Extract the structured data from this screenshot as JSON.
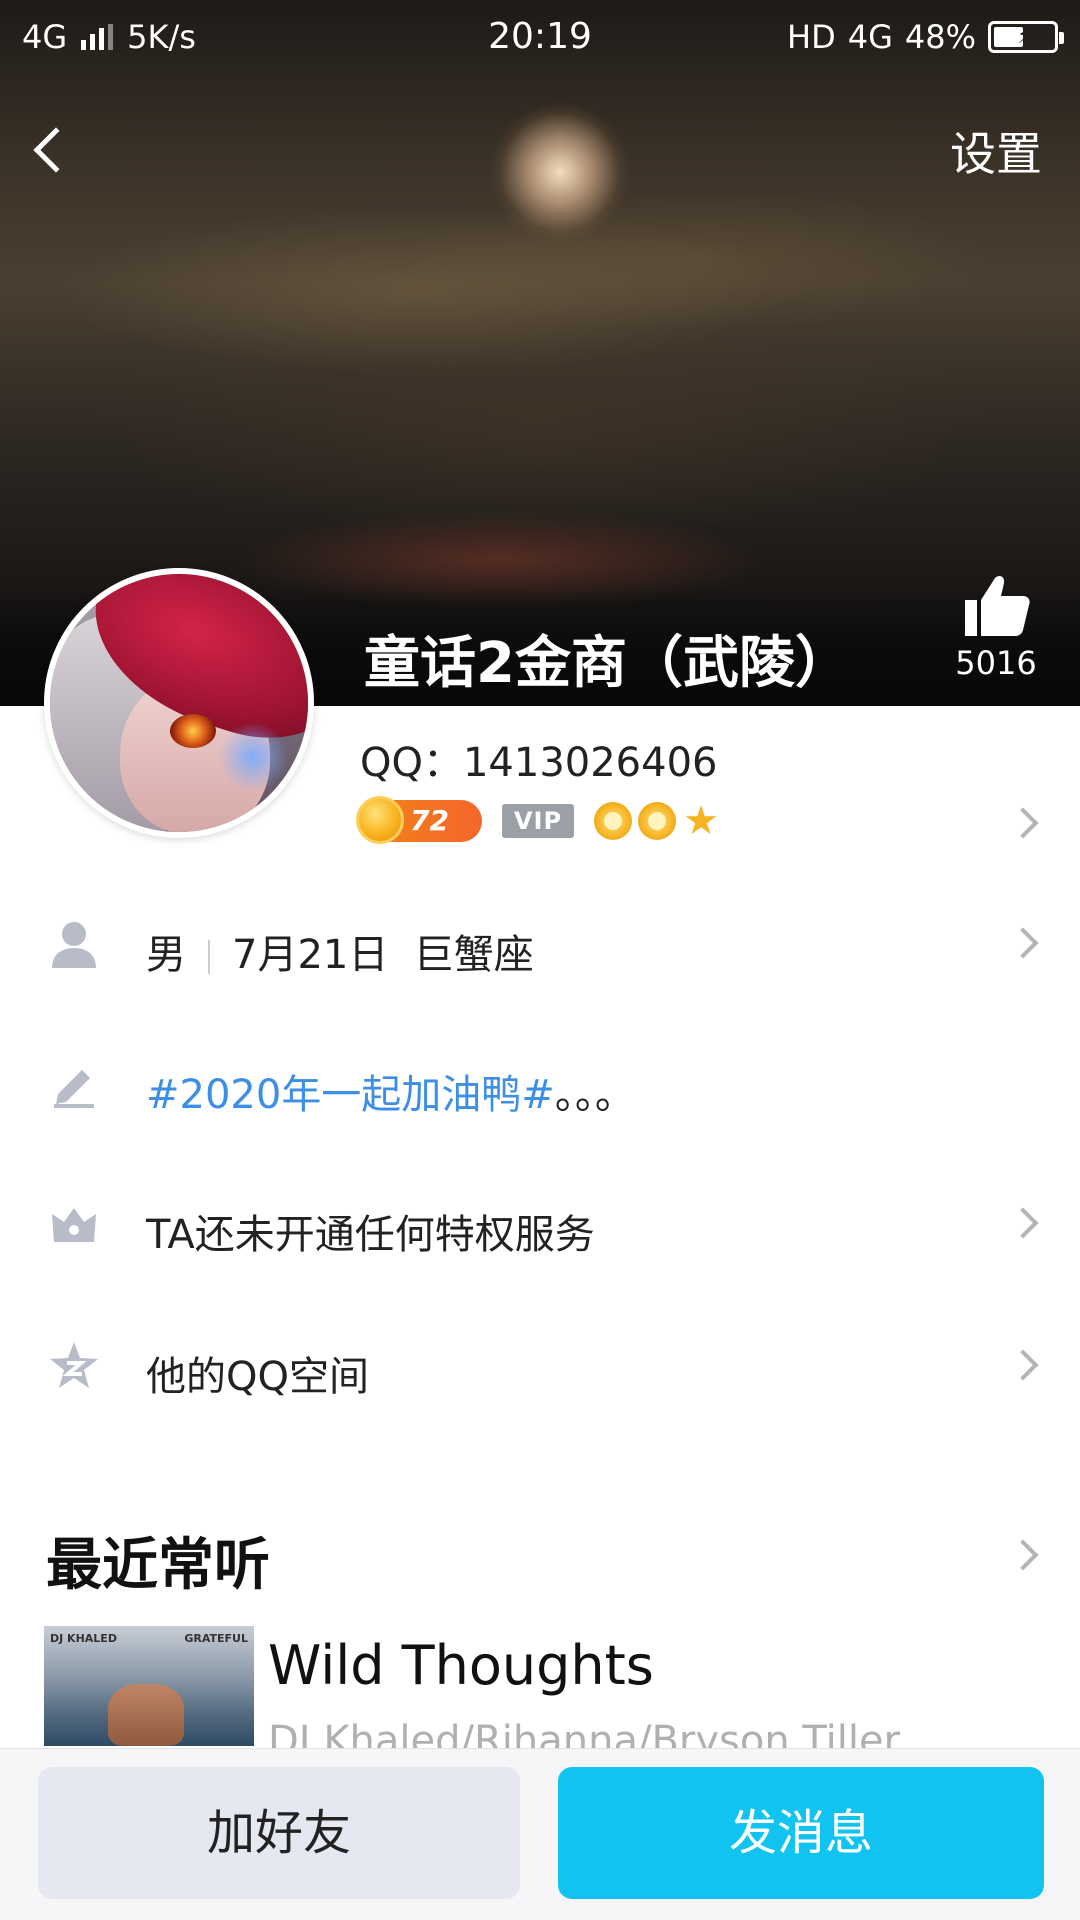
{
  "status_bar": {
    "network": "4G",
    "speed": "5K/s",
    "time": "20:19",
    "hd": "HD",
    "network_right": "4G",
    "battery": "48%"
  },
  "header": {
    "settings_label": "设置",
    "nickname": "童话2金商（武陵）",
    "likes": "5016"
  },
  "profile": {
    "qq_label": "QQ：",
    "qq_number": "1413026406",
    "level": "72",
    "vip_label": "VIP"
  },
  "info_rows": {
    "gender": "男",
    "birthday": "7月21日",
    "zodiac": "巨蟹座",
    "signature_tag": "#2020年一起加油鸭#",
    "signature_rest": "。。。",
    "privilege": "TA还未开通任何特权服务",
    "qzone": "他的QQ空间"
  },
  "music": {
    "section_title": "最近常听",
    "album_label_left": "DJ KHALED",
    "album_label_right": "GRATEFUL",
    "song_title": "Wild Thoughts",
    "song_artist": "DJ Khaled/Rihanna/Bryson Tiller"
  },
  "actions": {
    "add_friend": "加好友",
    "send_message": "发消息"
  },
  "colors": {
    "accent": "#10c3f0",
    "link_blue": "#3c8ee6"
  }
}
